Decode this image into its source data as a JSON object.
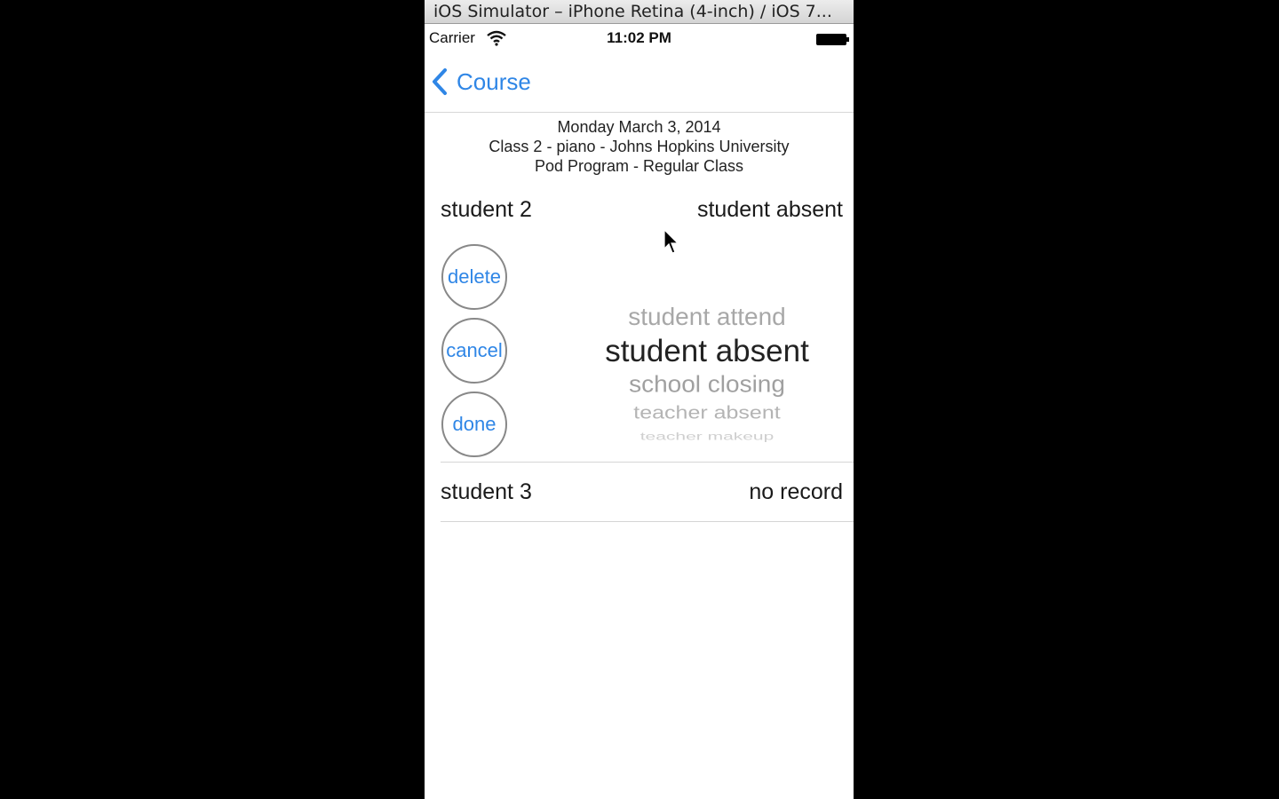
{
  "simulator": {
    "title": "iOS Simulator – iPhone Retina (4-inch) / iOS 7..."
  },
  "status_bar": {
    "carrier": "Carrier",
    "time": "11:02 PM"
  },
  "nav": {
    "back_label": "Course"
  },
  "header": {
    "date": "Monday March 3, 2014",
    "class_line": "Class 2 - piano - Johns Hopkins University",
    "program_line": "Pod Program - Regular Class"
  },
  "rows": [
    {
      "name": "student 2",
      "status": "student absent"
    },
    {
      "name": "student 3",
      "status": "no record"
    }
  ],
  "actions": {
    "delete": "delete",
    "cancel": "cancel",
    "done": "done"
  },
  "picker": {
    "options": [
      "student attend",
      "student absent",
      "school closing",
      "teacher absent",
      "teacher makeup"
    ],
    "selected": "student absent"
  },
  "colors": {
    "accent": "#2f86e6"
  }
}
